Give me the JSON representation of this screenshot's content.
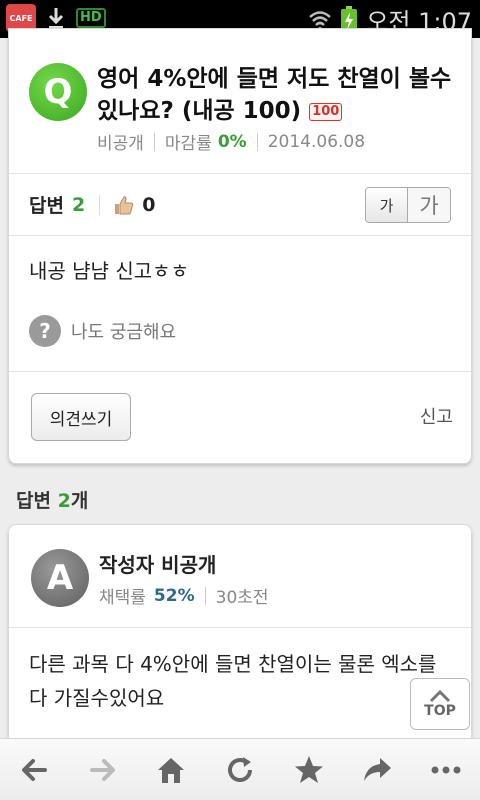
{
  "status_bar": {
    "app_icon_label": "CAFE",
    "hd_label": "HD",
    "time": "오전 1:07"
  },
  "question": {
    "badge": "Q",
    "title": "영어 4%안에 들면 저도 찬열이 볼수 있나요? (내공 100)",
    "reward_tag": "100",
    "author": "비공개",
    "deadline_label": "마감률",
    "deadline_value": "0%",
    "date": "2014.06.08",
    "answers_label": "답변",
    "answers_count": "2",
    "likes": "0",
    "font_small": "가",
    "font_large": "가",
    "body": "내공 냠냠 신고ㅎㅎ",
    "curious_label": "나도 궁금해요",
    "opinion_button": "의견쓰기",
    "report": "신고"
  },
  "answers_heading": {
    "label": "답변",
    "count": "2",
    "suffix": "개"
  },
  "answer": {
    "badge": "A",
    "author": "작성자 비공개",
    "adopt_label": "채택률",
    "adopt_value": "52%",
    "rank": "30초전",
    "body": "다른 과목 다 4%안에 들면 찬열이는 물론 엑소를 다 가질수있어요"
  },
  "top_button": "TOP",
  "colors": {
    "accent_green": "#3a9e35",
    "q_badge": "#3aa821",
    "answer_badge": "#5e5e5e"
  },
  "toolbar_icons": [
    "back-icon",
    "forward-icon",
    "home-icon",
    "refresh-icon",
    "star-icon",
    "share-icon",
    "more-icon"
  ]
}
